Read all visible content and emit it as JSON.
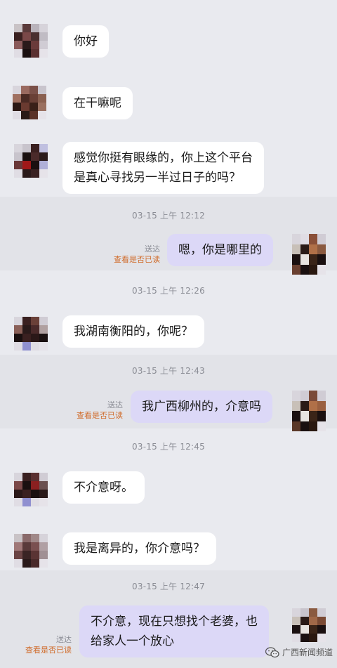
{
  "messages": [
    {
      "id": "m1",
      "side": "in",
      "text": "你好"
    },
    {
      "id": "m2",
      "side": "in",
      "text": "在干嘛呢"
    },
    {
      "id": "m3",
      "side": "in",
      "lines": [
        "感觉你挺有眼缘的，你上这个平台",
        "是真心寻找另一半过日子的吗？"
      ]
    },
    {
      "id": "m4",
      "side": "out",
      "time": "03-15 上午 12:12",
      "text": "嗯，你是哪里的",
      "status": "送达",
      "read_check": "查看是否已读"
    },
    {
      "id": "m5",
      "side": "in",
      "time": "03-15 上午 12:26",
      "text": "我湖南衡阳的，你呢？"
    },
    {
      "id": "m6",
      "side": "out",
      "time": "03-15 上午 12:43",
      "text": "我广西柳州的，介意吗",
      "status": "送达",
      "read_check": "查看是否已读"
    },
    {
      "id": "m7",
      "side": "in",
      "time": "03-15 上午 12:45",
      "text": "不介意呀。"
    },
    {
      "id": "m8",
      "side": "in",
      "text": "我是离异的，你介意吗？"
    },
    {
      "id": "m9",
      "side": "out",
      "time": "03-15 上午 12:47",
      "lines": [
        "不介意，现在只想找个老婆，也",
        "给家人一个放心"
      ],
      "status": "送达",
      "read_check": "查看是否已读"
    }
  ],
  "watermark": {
    "text": "广西新闻频道",
    "icon": "wechat-icon"
  },
  "colors": {
    "background": "#e9eaef",
    "incoming_bubble": "#ffffff",
    "outgoing_bubble": "#dcd8f7",
    "read_check": "#d06b2a",
    "timestamp": "#8a8c94"
  }
}
